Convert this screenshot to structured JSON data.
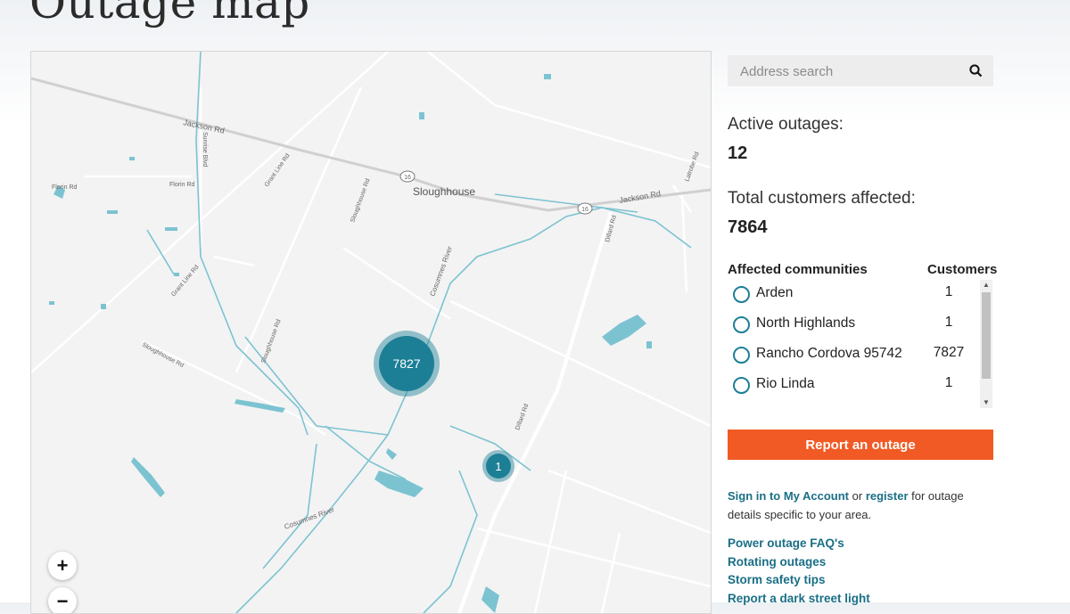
{
  "page": {
    "title": "Outage map"
  },
  "map": {
    "labels": {
      "jackson_rd_1": "Jackson Rd",
      "jackson_rd_2": "Jackson Rd",
      "florin_rd_1": "Florin Rd",
      "florin_rd_2": "Florin Rd",
      "sunrise_blvd": "Sunrise Blvd",
      "grant_line_rd_1": "Grant Line Rd",
      "grant_line_rd_2": "Grant Line Rd",
      "sloughhouse_rd_1": "Sloughhouse Rd",
      "sloughhouse_rd_2": "Sloughhouse Rd",
      "sloughhouse_rd_3": "Sloughhouse Rd",
      "sloughhouse_town": "Sloughhouse",
      "cosumnes_river_1": "Cosumnes River",
      "cosumnes_river_2": "Cosumnes River",
      "dillard_rd_1": "Dillard Rd",
      "dillard_rd_2": "Dillard Rd",
      "latrobe_rd": "Latrobe Rd",
      "route_16_a": "16",
      "route_16_b": "16"
    },
    "clusters": {
      "large": "7827",
      "small": "1"
    },
    "zoom": {
      "in": "+",
      "out": "−"
    },
    "colors": {
      "water": "#7cc3d1",
      "cluster": "#1c7f96",
      "road": "#ffffff",
      "major_road": "#d2d2d2"
    }
  },
  "search": {
    "placeholder": "Address search",
    "icon": "search-icon"
  },
  "stats": {
    "active_label": "Active outages:",
    "active_value": "12",
    "customers_label": "Total customers affected:",
    "customers_value": "7864"
  },
  "communities": {
    "header_name": "Affected communities",
    "header_count": "Customers",
    "rows": [
      {
        "name": "Arden",
        "count": "1"
      },
      {
        "name": "North Highlands",
        "count": "1"
      },
      {
        "name": "Rancho Cordova 95742",
        "count": "7827"
      },
      {
        "name": "Rio Linda",
        "count": "1"
      }
    ]
  },
  "report_button": "Report an outage",
  "signin": {
    "signin_link": "Sign in to My Account",
    "or": " or ",
    "register_link": "register",
    "rest": " for outage details specific to your area."
  },
  "links": [
    "Power outage FAQ's",
    "Rotating outages",
    "Storm safety tips",
    "Report a dark street light"
  ],
  "colors": {
    "accent": "#f15a24",
    "link": "#1a6f86",
    "teal": "#1c7f96"
  }
}
